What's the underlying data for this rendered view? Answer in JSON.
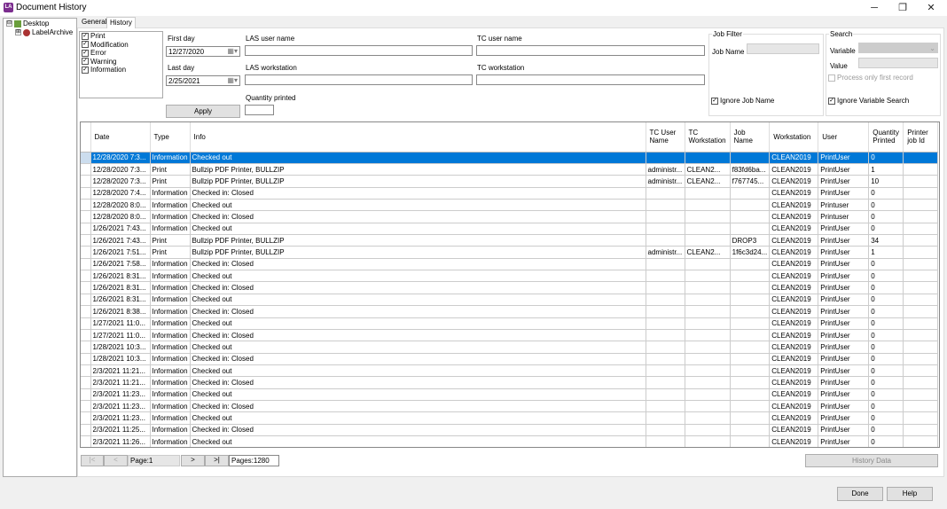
{
  "window": {
    "title": "Document History",
    "app_icon": "LA",
    "minimize": "─",
    "maximize": "❐",
    "close": "✕"
  },
  "tree": {
    "items": [
      {
        "label": "Desktop",
        "expander": "⊟"
      },
      {
        "label": "LabelArchive",
        "expander": "⊞"
      }
    ]
  },
  "tabs": [
    {
      "label": "General"
    },
    {
      "label": "History"
    }
  ],
  "event_types": [
    {
      "label": "Print",
      "checked": true
    },
    {
      "label": "Modification",
      "checked": true
    },
    {
      "label": "Error",
      "checked": true
    },
    {
      "label": "Warning",
      "checked": true
    },
    {
      "label": "Information",
      "checked": true
    }
  ],
  "filters": {
    "first_day_label": "First day",
    "first_day": "12/27/2020",
    "last_day_label": "Last day",
    "last_day": "2/25/2021",
    "las_user_label": "LAS user name",
    "las_user": "",
    "las_ws_label": "LAS workstation",
    "las_ws": "",
    "tc_user_label": "TC user name",
    "tc_user": "",
    "tc_ws_label": "TC workstation",
    "tc_ws": "",
    "qty_label": "Quantity printed",
    "qty": "",
    "apply": "Apply"
  },
  "job_filter": {
    "title": "Job Filter",
    "job_name_label": "Job Name",
    "job_name": "",
    "ignore_label": "Ignore Job Name",
    "ignore": true
  },
  "search": {
    "title": "Search",
    "variable_label": "Variable",
    "value_label": "Value",
    "first_record_label": "Process only first record",
    "ignore_label": "Ignore Variable Search",
    "ignore": true
  },
  "grid": {
    "columns": [
      "Date",
      "Type",
      "Info",
      "TC User Name",
      "TC Workstation",
      "Job Name",
      "Workstation",
      "User",
      "Quantity Printed",
      "Printer job Id"
    ],
    "selected_row": 0,
    "rows": [
      [
        "12/28/2020 7:3...",
        "Information",
        "Checked out",
        "",
        "",
        "",
        "CLEAN2019",
        "PrintUser",
        "0",
        ""
      ],
      [
        "12/28/2020 7:3...",
        "Print",
        "Bullzip PDF Printer, BULLZIP",
        "administr...",
        "CLEAN2...",
        "f83fd6ba...",
        "CLEAN2019",
        "PrintUser",
        "1",
        ""
      ],
      [
        "12/28/2020 7:3...",
        "Print",
        "Bullzip PDF Printer, BULLZIP",
        "administr...",
        "CLEAN2...",
        "f767745...",
        "CLEAN2019",
        "PrintUser",
        "10",
        ""
      ],
      [
        "12/28/2020 7:4...",
        "Information",
        "Checked in: Closed",
        "",
        "",
        "",
        "CLEAN2019",
        "PrintUser",
        "0",
        ""
      ],
      [
        "12/28/2020 8:0...",
        "Information",
        "Checked out",
        "",
        "",
        "",
        "CLEAN2019",
        "Printuser",
        "0",
        ""
      ],
      [
        "12/28/2020 8:0...",
        "Information",
        "Checked in: Closed",
        "",
        "",
        "",
        "CLEAN2019",
        "Printuser",
        "0",
        ""
      ],
      [
        "1/26/2021 7:43...",
        "Information",
        "Checked out",
        "",
        "",
        "",
        "CLEAN2019",
        "PrintUser",
        "0",
        ""
      ],
      [
        "1/26/2021 7:43...",
        "Print",
        "Bullzip PDF Printer, BULLZIP",
        "",
        "",
        "DROP3",
        "CLEAN2019",
        "PrintUser",
        "34",
        ""
      ],
      [
        "1/26/2021 7:51...",
        "Print",
        "Bullzip PDF Printer, BULLZIP",
        "administr...",
        "CLEAN2...",
        "1f6c3d24...",
        "CLEAN2019",
        "PrintUser",
        "1",
        ""
      ],
      [
        "1/26/2021 7:58...",
        "Information",
        "Checked in: Closed",
        "",
        "",
        "",
        "CLEAN2019",
        "PrintUser",
        "0",
        ""
      ],
      [
        "1/26/2021 8:31...",
        "Information",
        "Checked out",
        "",
        "",
        "",
        "CLEAN2019",
        "PrintUser",
        "0",
        ""
      ],
      [
        "1/26/2021 8:31...",
        "Information",
        "Checked in: Closed",
        "",
        "",
        "",
        "CLEAN2019",
        "PrintUser",
        "0",
        ""
      ],
      [
        "1/26/2021 8:31...",
        "Information",
        "Checked out",
        "",
        "",
        "",
        "CLEAN2019",
        "PrintUser",
        "0",
        ""
      ],
      [
        "1/26/2021 8:38...",
        "Information",
        "Checked in: Closed",
        "",
        "",
        "",
        "CLEAN2019",
        "PrintUser",
        "0",
        ""
      ],
      [
        "1/27/2021 11:0...",
        "Information",
        "Checked out",
        "",
        "",
        "",
        "CLEAN2019",
        "PrintUser",
        "0",
        ""
      ],
      [
        "1/27/2021 11:0...",
        "Information",
        "Checked in: Closed",
        "",
        "",
        "",
        "CLEAN2019",
        "PrintUser",
        "0",
        ""
      ],
      [
        "1/28/2021 10:3...",
        "Information",
        "Checked out",
        "",
        "",
        "",
        "CLEAN2019",
        "PrintUser",
        "0",
        ""
      ],
      [
        "1/28/2021 10:3...",
        "Information",
        "Checked in: Closed",
        "",
        "",
        "",
        "CLEAN2019",
        "PrintUser",
        "0",
        ""
      ],
      [
        "2/3/2021 11:21...",
        "Information",
        "Checked out",
        "",
        "",
        "",
        "CLEAN2019",
        "PrintUser",
        "0",
        ""
      ],
      [
        "2/3/2021 11:21...",
        "Information",
        "Checked in: Closed",
        "",
        "",
        "",
        "CLEAN2019",
        "PrintUser",
        "0",
        ""
      ],
      [
        "2/3/2021 11:23...",
        "Information",
        "Checked out",
        "",
        "",
        "",
        "CLEAN2019",
        "PrintUser",
        "0",
        ""
      ],
      [
        "2/3/2021 11:23...",
        "Information",
        "Checked in: Closed",
        "",
        "",
        "",
        "CLEAN2019",
        "PrintUser",
        "0",
        ""
      ],
      [
        "2/3/2021 11:23...",
        "Information",
        "Checked out",
        "",
        "",
        "",
        "CLEAN2019",
        "PrintUser",
        "0",
        ""
      ],
      [
        "2/3/2021 11:25...",
        "Information",
        "Checked in: Closed",
        "",
        "",
        "",
        "CLEAN2019",
        "PrintUser",
        "0",
        ""
      ],
      [
        "2/3/2021 11:26...",
        "Information",
        "Checked out",
        "",
        "",
        "",
        "CLEAN2019",
        "PrintUser",
        "0",
        ""
      ]
    ]
  },
  "pager": {
    "first": "|<",
    "prev": "<",
    "page": "Page:1",
    "next": ">",
    "last": ">|",
    "pages": "Pages:1280",
    "history_data": "History Data"
  },
  "footer": {
    "done": "Done",
    "help": "Help"
  },
  "colors": {
    "selection": "#0078d7",
    "app_icon": "#7b2d8e"
  }
}
